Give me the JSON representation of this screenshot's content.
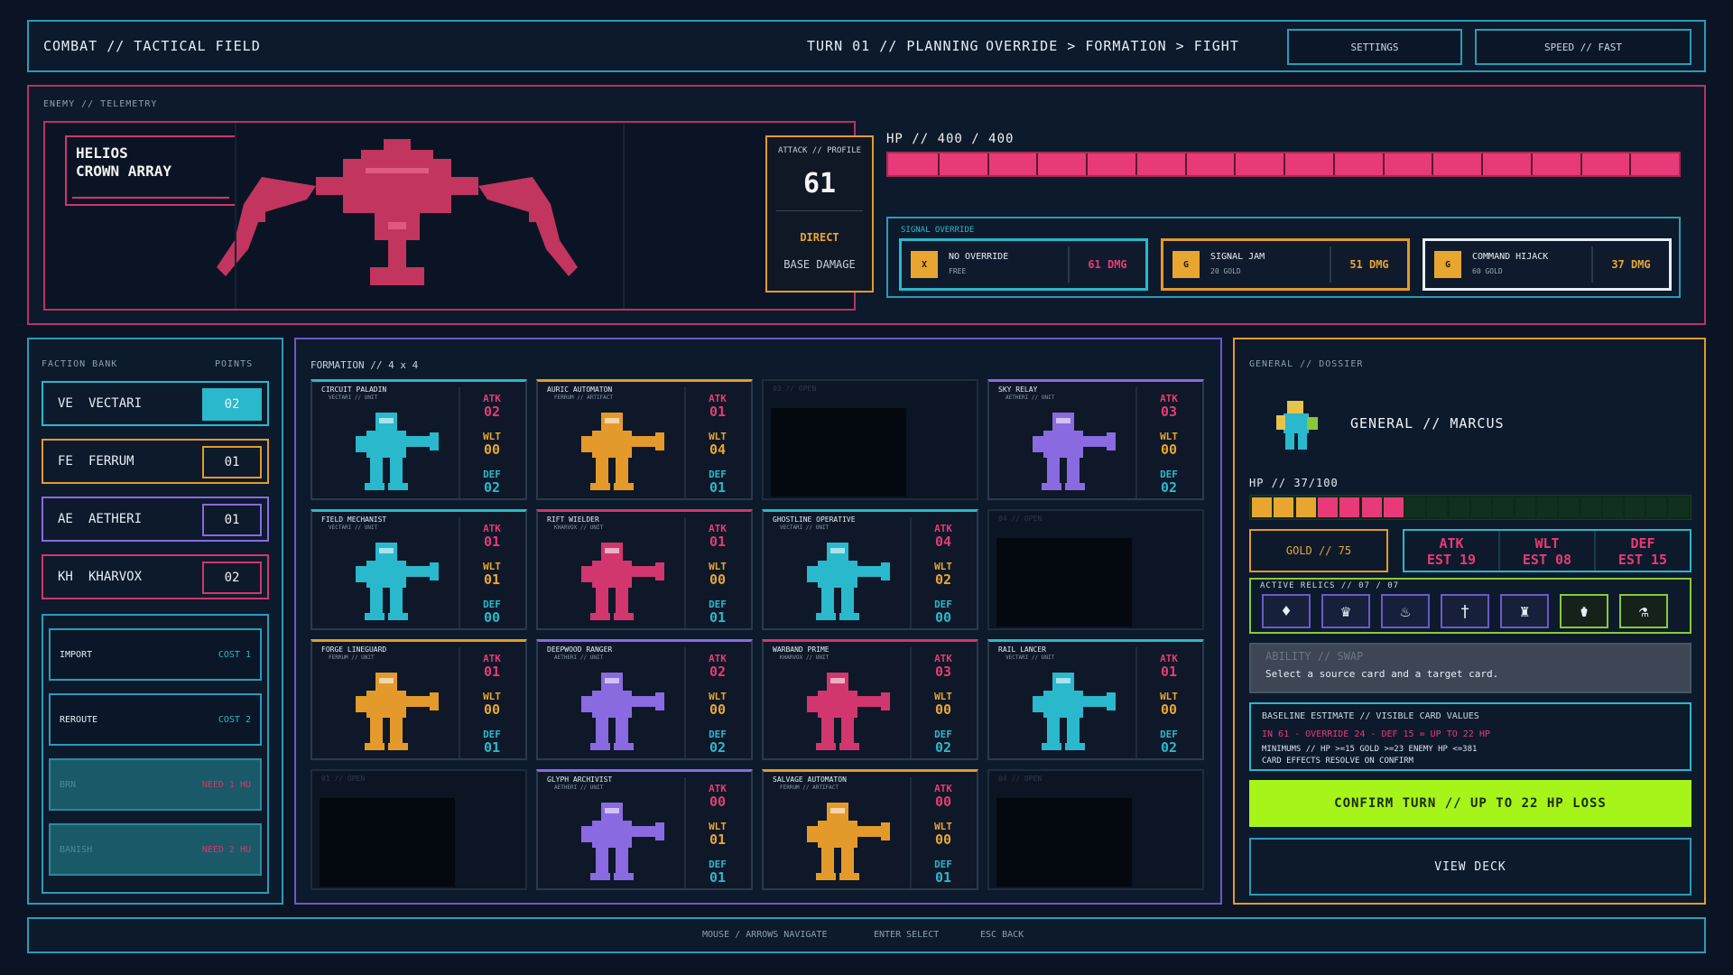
{
  "header": {
    "title": "COMBAT // TACTICAL FIELD",
    "turn": "TURN 01 // PLANNING",
    "phases": [
      "OVERRIDE",
      "FORMATION",
      "FIGHT"
    ],
    "phase_sep": ">",
    "settings_label": "SETTINGS",
    "speed_label": "SPEED // FAST"
  },
  "enemy": {
    "section_label": "ENEMY // TELEMETRY",
    "name_line1": "HELIOS",
    "name_line2": "CROWN ARRAY",
    "attack_profile": {
      "label": "ATTACK // PROFILE",
      "value": "61",
      "type": "DIRECT",
      "subtitle": "BASE DAMAGE"
    },
    "hp_label": "HP // 400 / 400",
    "hp_current": 400,
    "hp_max": 400,
    "hp_segments": 16
  },
  "signal_override": {
    "label": "SIGNAL OVERRIDE",
    "options": [
      {
        "icon": "X",
        "name": "NO OVERRIDE",
        "cost": "FREE",
        "damage": "61 DMG",
        "color": "#2ab8cc"
      },
      {
        "icon": "G",
        "name": "SIGNAL JAM",
        "cost": "20 GOLD",
        "damage": "51 DMG",
        "color": "#e49a2a"
      },
      {
        "icon": "G",
        "name": "COMMAND HIJACK",
        "cost": "60 GOLD",
        "damage": "37 DMG",
        "color": "#e6eef5"
      }
    ]
  },
  "faction_bank": {
    "label": "FACTION BANK",
    "points_label": "POINTS",
    "factions": [
      {
        "abbr": "VE",
        "name": "VECTARI",
        "points": "02",
        "color": "#2ab8cc",
        "filled": true
      },
      {
        "abbr": "FE",
        "name": "FERRUM",
        "points": "01",
        "color": "#e49a2a",
        "filled": false
      },
      {
        "abbr": "AE",
        "name": "AETHERI",
        "points": "01",
        "color": "#8a6ae0",
        "filled": false
      },
      {
        "abbr": "KH",
        "name": "KHARVOX",
        "points": "02",
        "color": "#d1366e",
        "filled": false
      }
    ],
    "actions": [
      {
        "name": "IMPORT",
        "cost": "COST 1",
        "disabled": false
      },
      {
        "name": "REROUTE",
        "cost": "COST 2",
        "disabled": false
      },
      {
        "name": "BRN",
        "cost": "NEED 1 HU",
        "disabled": true
      },
      {
        "name": "BANISH",
        "cost": "NEED 2 HU",
        "disabled": true
      }
    ]
  },
  "formation": {
    "label": "FORMATION // 4 x 4",
    "stat_labels": {
      "atk": "ATK",
      "wlt": "WLT",
      "def": "DEF"
    },
    "cards": [
      {
        "slot": "01",
        "name": "CIRCUIT PALADIN",
        "sub": "VECTARI // UNIT",
        "atk": "02",
        "wlt": "00",
        "def": "02",
        "color": "#2ab8cc",
        "sprite": "paladin-sprite",
        "empty": false
      },
      {
        "slot": "02",
        "name": "AURIC AUTOMATON",
        "sub": "FERRUM // ARTIFACT",
        "atk": "01",
        "wlt": "04",
        "def": "01",
        "color": "#e49a2a",
        "sprite": "automaton-sprite",
        "empty": false
      },
      {
        "slot": "03",
        "name": "03 // OPEN",
        "empty": true
      },
      {
        "slot": "04",
        "name": "SKY RELAY",
        "sub": "AETHERI // UNIT",
        "atk": "03",
        "wlt": "00",
        "def": "02",
        "color": "#8a6ae0",
        "sprite": "relay-sprite",
        "empty": false
      },
      {
        "slot": "01",
        "name": "FIELD MECHANIST",
        "sub": "VECTARI // UNIT",
        "atk": "01",
        "wlt": "01",
        "def": "00",
        "color": "#2ab8cc",
        "sprite": "mechanist-sprite",
        "empty": false
      },
      {
        "slot": "02",
        "name": "RIFT WIELDER",
        "sub": "KHARVOX // UNIT",
        "atk": "01",
        "wlt": "00",
        "def": "01",
        "color": "#d1366e",
        "sprite": "wielder-sprite",
        "empty": false
      },
      {
        "slot": "03",
        "name": "GHOSTLINE OPERATIVE",
        "sub": "VECTARI // UNIT",
        "atk": "04",
        "wlt": "02",
        "def": "00",
        "color": "#2ab8cc",
        "sprite": "operative-sprite",
        "empty": false
      },
      {
        "slot": "04",
        "name": "04 // OPEN",
        "empty": true
      },
      {
        "slot": "01",
        "name": "FORGE LINEGUARD",
        "sub": "FERRUM // UNIT",
        "atk": "01",
        "wlt": "00",
        "def": "01",
        "color": "#e49a2a",
        "sprite": "lineguard-sprite",
        "empty": false
      },
      {
        "slot": "02",
        "name": "DEEPWOOD RANGER",
        "sub": "AETHERI // UNIT",
        "atk": "02",
        "wlt": "00",
        "def": "02",
        "color": "#8a6ae0",
        "sprite": "ranger-sprite",
        "empty": false
      },
      {
        "slot": "03",
        "name": "WARBAND PRIME",
        "sub": "KHARVOX // UNIT",
        "atk": "03",
        "wlt": "00",
        "def": "02",
        "color": "#d1366e",
        "sprite": "prime-sprite",
        "empty": false
      },
      {
        "slot": "04",
        "name": "RAIL LANCER",
        "sub": "VECTARI // UNIT",
        "atk": "01",
        "wlt": "00",
        "def": "02",
        "color": "#2ab8cc",
        "sprite": "lancer-sprite",
        "empty": false
      },
      {
        "slot": "01",
        "name": "01 // OPEN",
        "empty": true
      },
      {
        "slot": "02",
        "name": "GLYPH ARCHIVIST",
        "sub": "AETHERI // UNIT",
        "atk": "00",
        "wlt": "01",
        "def": "01",
        "color": "#8a6ae0",
        "sprite": "archivist-sprite",
        "empty": false
      },
      {
        "slot": "03",
        "name": "SALVAGE AUTOMATON",
        "sub": "FERRUM // ARTIFACT",
        "atk": "00",
        "wlt": "00",
        "def": "01",
        "color": "#e49a2a",
        "sprite": "salvage-sprite",
        "empty": false
      },
      {
        "slot": "04",
        "name": "04 // OPEN",
        "empty": true
      }
    ]
  },
  "general": {
    "section_label": "GENERAL // DOSSIER",
    "name": "GENERAL // MARCUS",
    "hp_label": "HP // 37/100",
    "hp_current": 37,
    "hp_max": 100,
    "gold_label": "GOLD // 75",
    "estimates": [
      {
        "stat": "ATK",
        "est": "EST 19"
      },
      {
        "stat": "WLT",
        "est": "EST 08"
      },
      {
        "stat": "DEF",
        "est": "EST 15"
      }
    ],
    "relics_label": "ACTIVE RELICS // 07 / 07",
    "relics": [
      "drop-relic-icon",
      "crown-relic-icon",
      "flask-relic-icon",
      "sword-relic-icon",
      "tower-relic-icon",
      "vial-relic-icon",
      "bottle-relic-icon"
    ],
    "ability_title": "ABILITY // SWAP",
    "ability_hint": "Select a source card and a target card.",
    "baseline_title": "BASELINE ESTIMATE // VISIBLE CARD VALUES",
    "baseline_line": "IN 61 - OVERRIDE 24 - DEF 15 = UP TO 22 HP",
    "baseline_minimums": "MINIMUMS // HP >=15    GOLD >=23    ENEMY HP <=381",
    "baseline_note": "CARD EFFECTS RESOLVE ON CONFIRM",
    "confirm_label": "CONFIRM TURN // UP TO 22 HP LOSS",
    "view_deck_label": "VIEW DECK"
  },
  "footer": {
    "hints": [
      "MOUSE / ARROWS  NAVIGATE",
      "ENTER  SELECT",
      "ESC  BACK"
    ]
  }
}
